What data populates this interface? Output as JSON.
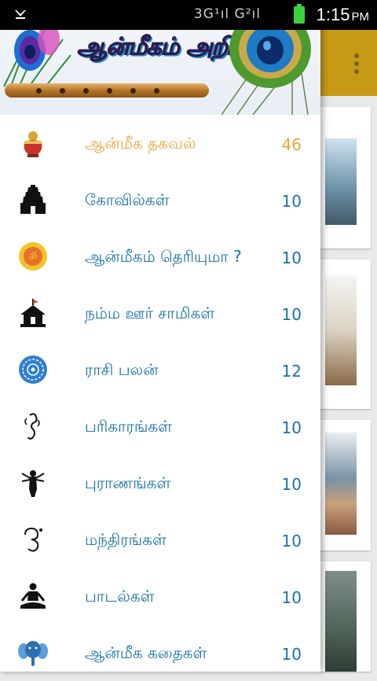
{
  "status_bar": {
    "network": "3G¹ıl  G²ıl",
    "time": "1:15",
    "ampm": "PM"
  },
  "app": {
    "title": "ஆன்மீகம் அறிவோம்"
  },
  "menu": [
    {
      "label": "ஆன்மீக தகவல்",
      "count": "46",
      "icon": "kalasam-icon",
      "active": true
    },
    {
      "label": "கோவில்கள்",
      "count": "10",
      "icon": "temple-tower-icon"
    },
    {
      "label": "ஆன்மீகம் தெரியுமா ?",
      "count": "10",
      "icon": "om-sun-icon"
    },
    {
      "label": "நம்ம ஊர் சாமிகள்",
      "count": "10",
      "icon": "village-shrine-icon"
    },
    {
      "label": "ராசி பலன்",
      "count": "12",
      "icon": "zodiac-wheel-icon"
    },
    {
      "label": "பரிகாரங்கள்",
      "count": "10",
      "icon": "ganesha-icon"
    },
    {
      "label": "புராணங்கள்",
      "count": "10",
      "icon": "deity-icon"
    },
    {
      "label": "மந்திரங்கள்",
      "count": "10",
      "icon": "om-symbol-icon"
    },
    {
      "label": "பாடல்கள்",
      "count": "10",
      "icon": "meditation-icon"
    },
    {
      "label": "ஆன்மீக கதைகள்",
      "count": "10",
      "icon": "elephant-icon"
    }
  ],
  "colors": {
    "active": "#e9a43a",
    "item": "#1872a5",
    "app_bar": "#c79a16"
  }
}
